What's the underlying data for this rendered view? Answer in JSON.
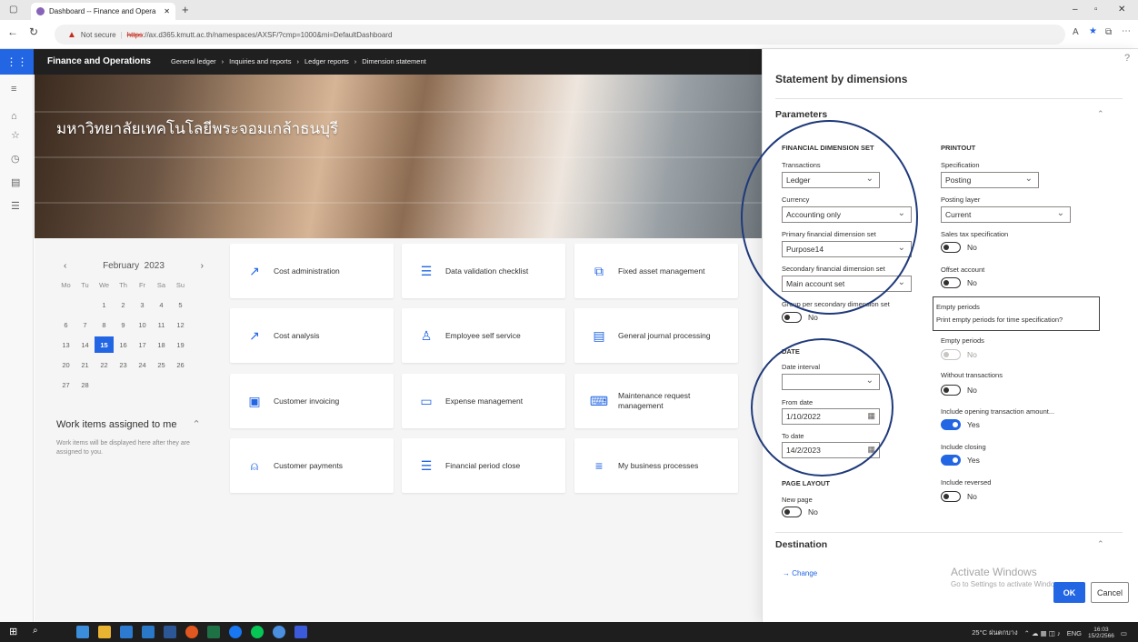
{
  "browser": {
    "tab_title": "Dashboard -- Finance and Opera",
    "not_secure": "Not secure",
    "url_https": "https",
    "url_rest": "://ax.d365.kmutt.ac.th/namespaces/AXSF/?cmp=1000&mi=DefaultDashboard"
  },
  "appbar": {
    "title": "Finance and Operations",
    "breadcrumbs": [
      "General ledger",
      "Inquiries and reports",
      "Ledger reports",
      "Dimension statement"
    ]
  },
  "hero": {
    "title": "มหาวิทยาลัยเทคโนโลยีพระจอมเกล้าธนบุรี"
  },
  "calendar": {
    "month": "February",
    "year": "2023",
    "weekdays": [
      "Mo",
      "Tu",
      "We",
      "Th",
      "Fr",
      "Sa",
      "Su"
    ],
    "weeks": [
      [
        "",
        "",
        "1",
        "2",
        "3",
        "4",
        "5"
      ],
      [
        "6",
        "7",
        "8",
        "9",
        "10",
        "11",
        "12"
      ],
      [
        "13",
        "14",
        "15",
        "16",
        "17",
        "18",
        "19"
      ],
      [
        "20",
        "21",
        "22",
        "23",
        "24",
        "25",
        "26"
      ],
      [
        "27",
        "28",
        "",
        "",
        "",
        "",
        ""
      ]
    ],
    "today": "15"
  },
  "work_items": {
    "title": "Work items assigned to me",
    "desc": "Work items will be displayed here after they are assigned to you."
  },
  "tiles": [
    {
      "label": "Cost administration",
      "icon": "chart-trend-icon"
    },
    {
      "label": "Data validation checklist",
      "icon": "checklist-icon"
    },
    {
      "label": "Fixed asset management",
      "icon": "asset-icon"
    },
    {
      "label": "Cost analysis",
      "icon": "chart-trend-icon"
    },
    {
      "label": "Employee self service",
      "icon": "person-icon"
    },
    {
      "label": "General journal processing",
      "icon": "journal-icon"
    },
    {
      "label": "Customer invoicing",
      "icon": "invoice-icon"
    },
    {
      "label": "Expense management",
      "icon": "expense-icon"
    },
    {
      "label": "Maintenance request management",
      "icon": "maintenance-icon"
    },
    {
      "label": "Customer payments",
      "icon": "payment-icon"
    },
    {
      "label": "Financial period close",
      "icon": "checklist-icon"
    },
    {
      "label": "My business processes",
      "icon": "process-icon"
    }
  ],
  "panel": {
    "title": "Statement by dimensions",
    "help": "?",
    "parameters": "Parameters",
    "fin_dim_set": "FINANCIAL DIMENSION SET",
    "transactions_label": "Transactions",
    "transactions_value": "Ledger",
    "currency_label": "Currency",
    "currency_value": "Accounting only",
    "primary_label": "Primary financial dimension set",
    "primary_value": "Purpose14",
    "secondary_label": "Secondary financial dimension set",
    "secondary_value": "Main account set",
    "group_label": "Group per secondary dimension set",
    "group_value": "No",
    "date_hd": "DATE",
    "date_interval_label": "Date interval",
    "date_interval_value": "",
    "from_label": "From date",
    "from_value": "1/10/2022",
    "to_label": "To date",
    "to_value": "14/2/2023",
    "page_layout": "PAGE LAYOUT",
    "new_page_label": "New page",
    "new_page_value": "No",
    "printout": "PRINTOUT",
    "spec_label": "Specification",
    "spec_value": "Posting",
    "posting_layer_label": "Posting layer",
    "posting_layer_value": "Current",
    "sales_tax_label": "Sales tax specification",
    "sales_tax_value": "No",
    "offset_label": "Offset account",
    "offset_value": "No",
    "empty_label": "Empty periods",
    "empty_value": "No",
    "without_label": "Without transactions",
    "without_value": "No",
    "opening_label": "Include opening transaction amount...",
    "opening_value": "Yes",
    "closing_label": "Include closing",
    "closing_value": "Yes",
    "reversed_label": "Include reversed",
    "reversed_value": "No",
    "tooltip_title": "Empty periods",
    "tooltip_text": "Print empty periods for time specification?",
    "destination": "Destination",
    "change": "→ Change",
    "ok": "OK",
    "cancel": "Cancel"
  },
  "watermark": {
    "line1": "Activate Windows",
    "line2": "Go to Settings to activate Windows."
  },
  "tray": {
    "weather": "25°C ฝนตกบาง",
    "lang": "ENG",
    "time": "16:03",
    "date": "15/2/2566"
  },
  "colors": {
    "accent": "#2266e3",
    "annotation": "#1f3a7a"
  }
}
